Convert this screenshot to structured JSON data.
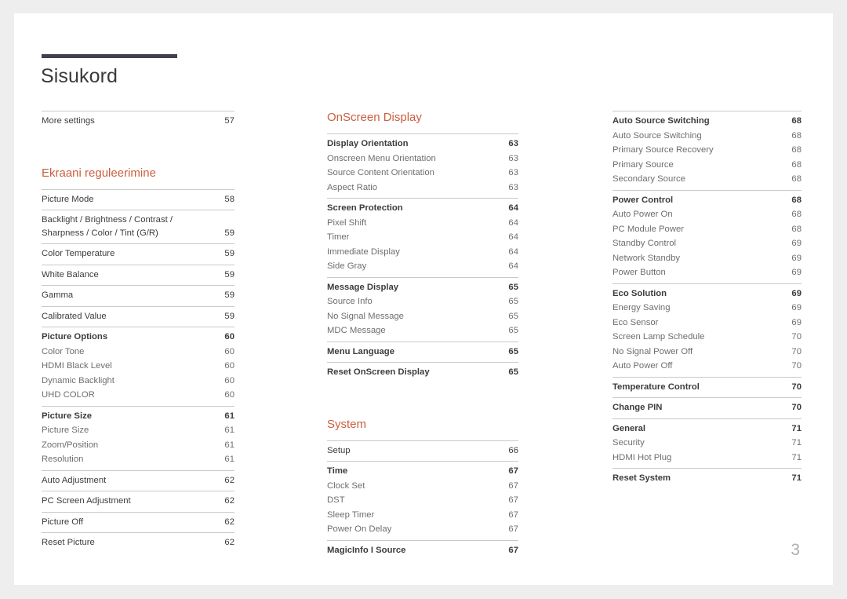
{
  "document": {
    "title": "Sisukord",
    "page_number": "3",
    "accent_color": "#ca5f40",
    "rule_color": "#434050"
  },
  "columns": [
    {
      "name": "column-1",
      "blocks": [
        {
          "type": "group",
          "rows": [
            {
              "label": "More settings",
              "page": "57",
              "level": "plain"
            }
          ]
        },
        {
          "type": "spacer",
          "size": "lg"
        },
        {
          "type": "heading",
          "text": "Ekraani reguleerimine"
        },
        {
          "type": "group",
          "rows": [
            {
              "label": "Picture Mode",
              "page": "58",
              "level": "plain"
            }
          ]
        },
        {
          "type": "group",
          "rows": [
            {
              "label": "Backlight / Brightness / Contrast / Sharpness / Color / Tint (G/R)",
              "page": "59",
              "level": "plain"
            }
          ]
        },
        {
          "type": "group",
          "rows": [
            {
              "label": "Color Temperature",
              "page": "59",
              "level": "plain"
            }
          ]
        },
        {
          "type": "group",
          "rows": [
            {
              "label": "White Balance",
              "page": "59",
              "level": "plain"
            }
          ]
        },
        {
          "type": "group",
          "rows": [
            {
              "label": "Gamma",
              "page": "59",
              "level": "plain"
            }
          ]
        },
        {
          "type": "group",
          "rows": [
            {
              "label": "Calibrated Value",
              "page": "59",
              "level": "plain"
            }
          ]
        },
        {
          "type": "group",
          "rows": [
            {
              "label": "Picture Options",
              "page": "60",
              "level": "main"
            },
            {
              "label": "Color Tone",
              "page": "60",
              "level": "sub"
            },
            {
              "label": "HDMI Black Level",
              "page": "60",
              "level": "sub"
            },
            {
              "label": "Dynamic Backlight",
              "page": "60",
              "level": "sub"
            },
            {
              "label": "UHD COLOR",
              "page": "60",
              "level": "sub"
            }
          ]
        },
        {
          "type": "group",
          "rows": [
            {
              "label": "Picture Size",
              "page": "61",
              "level": "main"
            },
            {
              "label": "Picture Size",
              "page": "61",
              "level": "sub"
            },
            {
              "label": "Zoom/Position",
              "page": "61",
              "level": "sub"
            },
            {
              "label": "Resolution",
              "page": "61",
              "level": "sub"
            }
          ]
        },
        {
          "type": "group",
          "rows": [
            {
              "label": "Auto Adjustment",
              "page": "62",
              "level": "plain"
            }
          ]
        },
        {
          "type": "group",
          "rows": [
            {
              "label": "PC Screen Adjustment",
              "page": "62",
              "level": "plain"
            }
          ]
        },
        {
          "type": "group",
          "rows": [
            {
              "label": "Picture Off",
              "page": "62",
              "level": "plain"
            }
          ]
        },
        {
          "type": "group",
          "rows": [
            {
              "label": "Reset Picture",
              "page": "62",
              "level": "plain"
            }
          ]
        }
      ]
    },
    {
      "name": "column-2",
      "blocks": [
        {
          "type": "heading",
          "text": "OnScreen Display"
        },
        {
          "type": "group",
          "rows": [
            {
              "label": "Display Orientation",
              "page": "63",
              "level": "main"
            },
            {
              "label": "Onscreen Menu Orientation",
              "page": "63",
              "level": "sub"
            },
            {
              "label": "Source Content Orientation",
              "page": "63",
              "level": "sub"
            },
            {
              "label": "Aspect Ratio",
              "page": "63",
              "level": "sub"
            }
          ]
        },
        {
          "type": "group",
          "rows": [
            {
              "label": "Screen Protection",
              "page": "64",
              "level": "main"
            },
            {
              "label": "Pixel Shift",
              "page": "64",
              "level": "sub"
            },
            {
              "label": "Timer",
              "page": "64",
              "level": "sub"
            },
            {
              "label": "Immediate Display",
              "page": "64",
              "level": "sub"
            },
            {
              "label": "Side Gray",
              "page": "64",
              "level": "sub"
            }
          ]
        },
        {
          "type": "group",
          "rows": [
            {
              "label": "Message Display",
              "page": "65",
              "level": "main"
            },
            {
              "label": "Source Info",
              "page": "65",
              "level": "sub"
            },
            {
              "label": "No Signal Message",
              "page": "65",
              "level": "sub"
            },
            {
              "label": "MDC Message",
              "page": "65",
              "level": "sub"
            }
          ]
        },
        {
          "type": "group",
          "rows": [
            {
              "label": "Menu Language",
              "page": "65",
              "level": "main"
            }
          ]
        },
        {
          "type": "group",
          "rows": [
            {
              "label": "Reset OnScreen Display",
              "page": "65",
              "level": "main"
            }
          ]
        },
        {
          "type": "spacer",
          "size": "lg"
        },
        {
          "type": "heading",
          "text": "System"
        },
        {
          "type": "group",
          "rows": [
            {
              "label": "Setup",
              "page": "66",
              "level": "plain"
            }
          ]
        },
        {
          "type": "group",
          "rows": [
            {
              "label": "Time",
              "page": "67",
              "level": "main"
            },
            {
              "label": "Clock Set",
              "page": "67",
              "level": "sub"
            },
            {
              "label": "DST",
              "page": "67",
              "level": "sub"
            },
            {
              "label": "Sleep Timer",
              "page": "67",
              "level": "sub"
            },
            {
              "label": "Power On Delay",
              "page": "67",
              "level": "sub"
            }
          ]
        },
        {
          "type": "group",
          "rows": [
            {
              "label": "MagicInfo I Source",
              "page": "67",
              "level": "main"
            }
          ]
        }
      ]
    },
    {
      "name": "column-3",
      "blocks": [
        {
          "type": "group",
          "rows": [
            {
              "label": "Auto Source Switching",
              "page": "68",
              "level": "main"
            },
            {
              "label": "Auto Source Switching",
              "page": "68",
              "level": "sub"
            },
            {
              "label": "Primary Source Recovery",
              "page": "68",
              "level": "sub"
            },
            {
              "label": "Primary Source",
              "page": "68",
              "level": "sub"
            },
            {
              "label": "Secondary Source",
              "page": "68",
              "level": "sub"
            }
          ]
        },
        {
          "type": "group",
          "rows": [
            {
              "label": "Power Control",
              "page": "68",
              "level": "main"
            },
            {
              "label": "Auto Power On",
              "page": "68",
              "level": "sub"
            },
            {
              "label": "PC Module Power",
              "page": "68",
              "level": "sub"
            },
            {
              "label": "Standby Control",
              "page": "69",
              "level": "sub"
            },
            {
              "label": "Network Standby",
              "page": "69",
              "level": "sub"
            },
            {
              "label": "Power Button",
              "page": "69",
              "level": "sub"
            }
          ]
        },
        {
          "type": "group",
          "rows": [
            {
              "label": "Eco Solution",
              "page": "69",
              "level": "main"
            },
            {
              "label": "Energy Saving",
              "page": "69",
              "level": "sub"
            },
            {
              "label": "Eco Sensor",
              "page": "69",
              "level": "sub"
            },
            {
              "label": "Screen Lamp Schedule",
              "page": "70",
              "level": "sub"
            },
            {
              "label": "No Signal Power Off",
              "page": "70",
              "level": "sub"
            },
            {
              "label": "Auto Power Off",
              "page": "70",
              "level": "sub"
            }
          ]
        },
        {
          "type": "group",
          "rows": [
            {
              "label": "Temperature Control",
              "page": "70",
              "level": "main"
            }
          ]
        },
        {
          "type": "group",
          "rows": [
            {
              "label": "Change PIN",
              "page": "70",
              "level": "main"
            }
          ]
        },
        {
          "type": "group",
          "rows": [
            {
              "label": "General",
              "page": "71",
              "level": "main"
            },
            {
              "label": "Security",
              "page": "71",
              "level": "sub"
            },
            {
              "label": "HDMI Hot Plug",
              "page": "71",
              "level": "sub"
            }
          ]
        },
        {
          "type": "group",
          "rows": [
            {
              "label": "Reset System",
              "page": "71",
              "level": "main"
            }
          ]
        }
      ]
    }
  ]
}
